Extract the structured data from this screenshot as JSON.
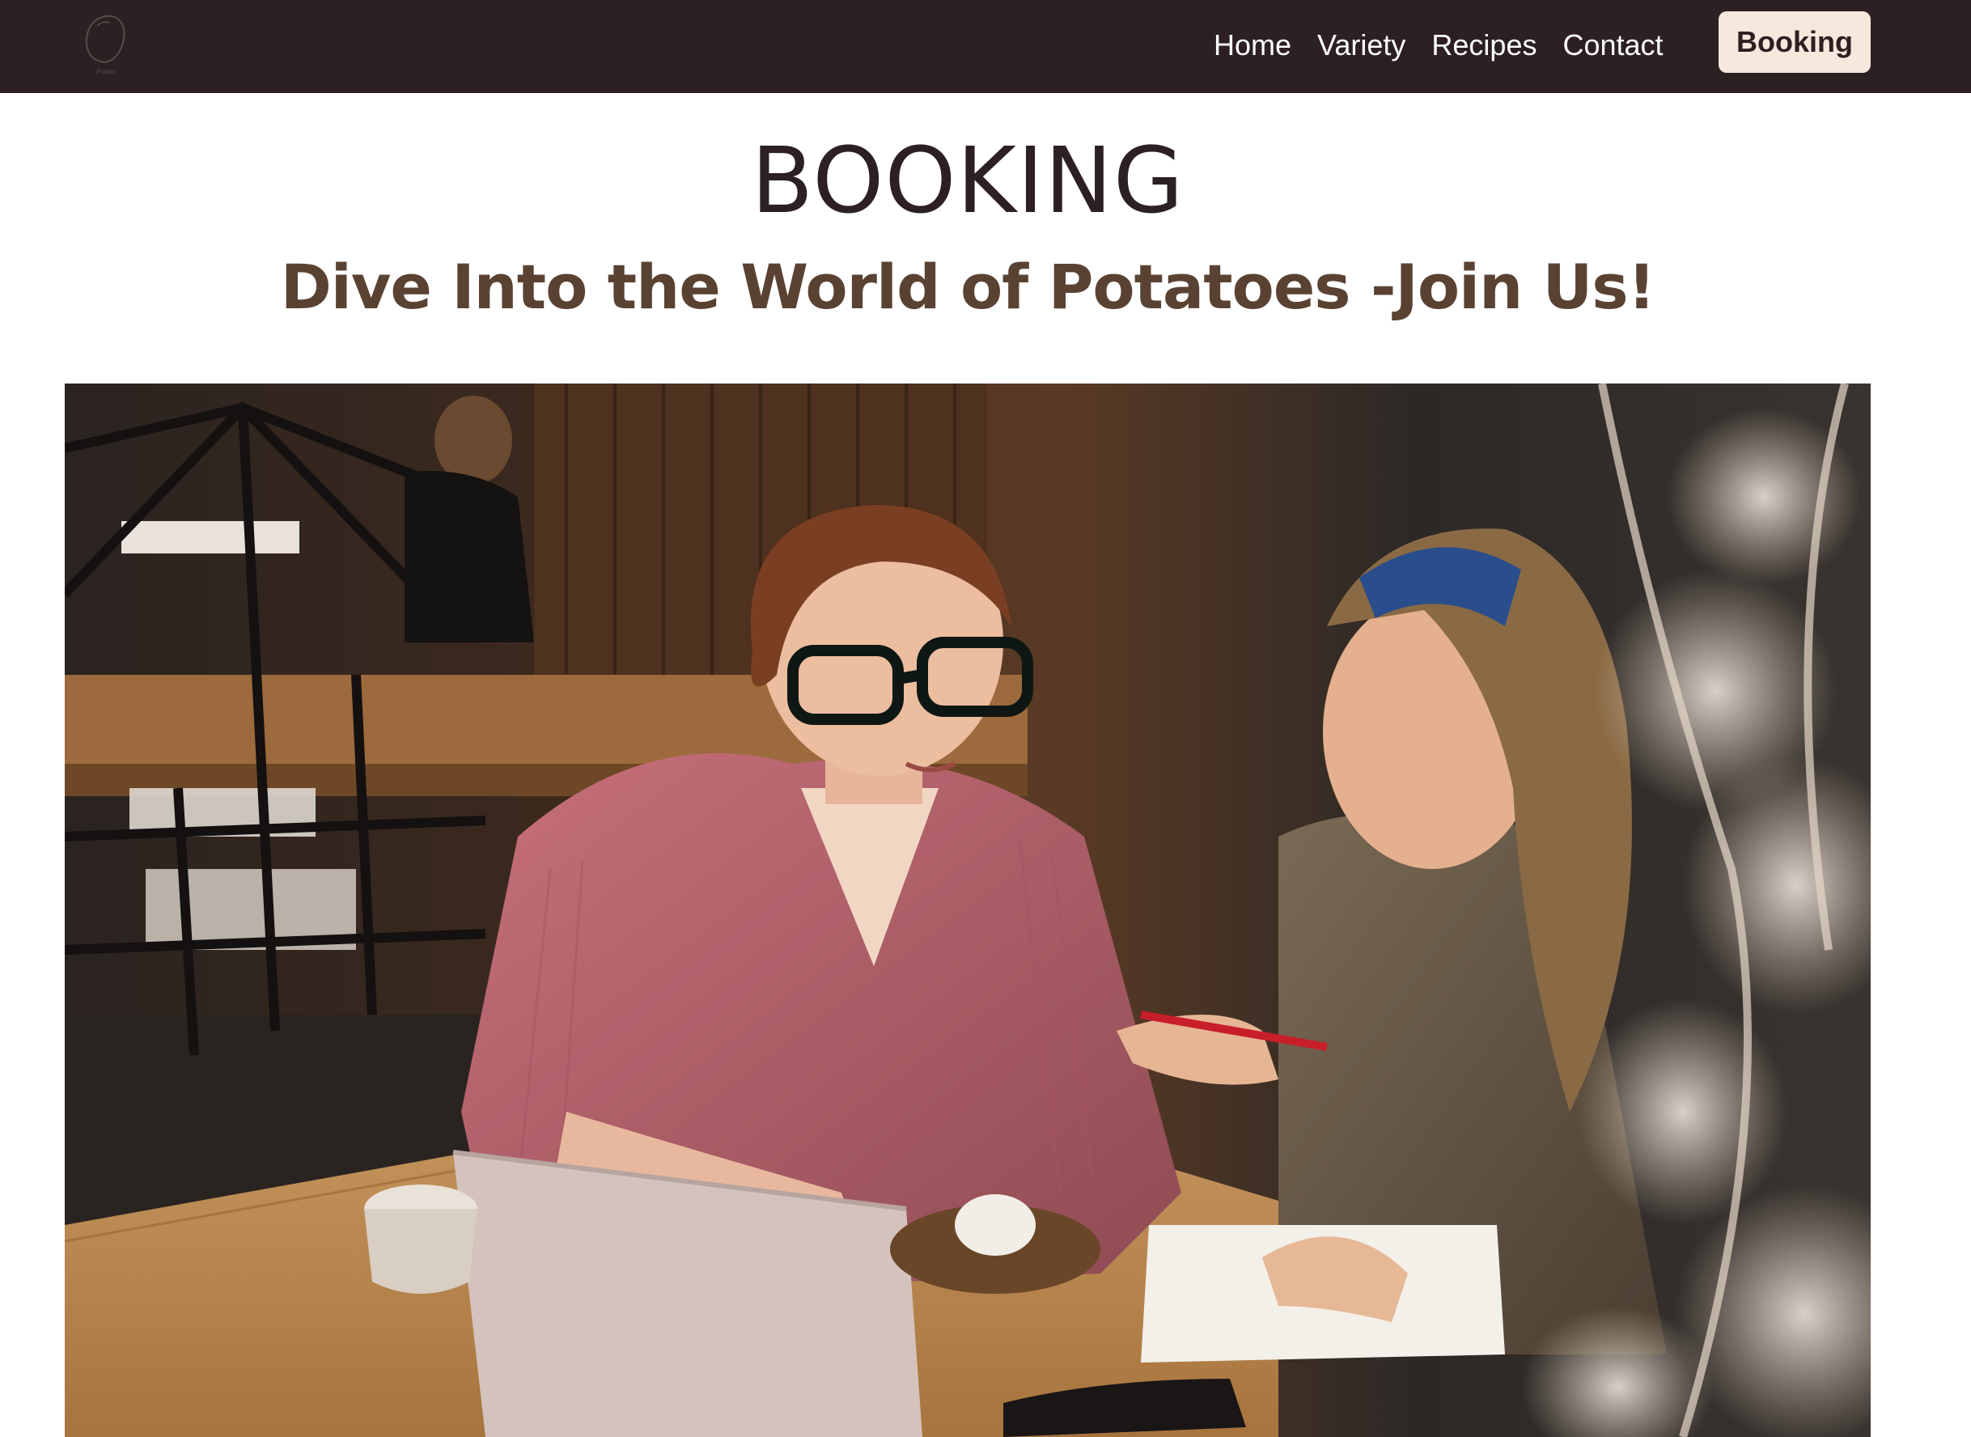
{
  "header": {
    "logo_label": "Potato",
    "nav_items": [
      {
        "label": "Home"
      },
      {
        "label": "Variety"
      },
      {
        "label": "Recipes"
      },
      {
        "label": "Contact"
      }
    ],
    "booking_button": "Booking"
  },
  "main": {
    "title": "BOOKING",
    "subtitle": "Dive Into the World of Potatoes -Join Us!",
    "hero_image": {
      "icon": "photo-two-women-at-cafe-table"
    }
  },
  "colors": {
    "navbar_bg": "#2c2022",
    "button_bg": "#f6e8dd",
    "title": "#2c2022",
    "subtitle": "#5a4233"
  }
}
